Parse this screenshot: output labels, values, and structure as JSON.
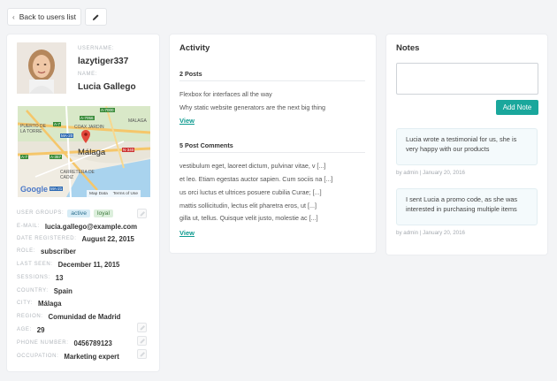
{
  "toolbar": {
    "back_label": "Back to users list",
    "back_icon": "chevron-left-icon",
    "edit_icon": "pencil-icon"
  },
  "profile": {
    "username_label": "USERNAME:",
    "username": "lazytiger337",
    "name_label": "NAME:",
    "name": "Lucia Gallego",
    "map": {
      "labels": [
        "PUERTO DE LA TORRE",
        "COAX JARDIN",
        "MALAGA",
        "Málaga",
        "CARRETERA DE CADIZ",
        "A-7",
        "MA-20",
        "A-357",
        "A-7056",
        "A-7000",
        "N-340",
        "MA-21",
        "A-7"
      ],
      "footer_left": "Google",
      "footer_mid": "Map Data",
      "footer_right": "Terms of Use"
    },
    "fields": [
      {
        "label": "USER GROUPS:",
        "value": "",
        "tags": [
          "active",
          "loyal"
        ],
        "editable": true
      },
      {
        "label": "E-MAIL:",
        "value": "lucia.gallego@example.com",
        "editable": false
      },
      {
        "label": "DATE REGISTERED:",
        "value": "August 22, 2015",
        "editable": false
      },
      {
        "label": "ROLE:",
        "value": "subscriber",
        "editable": false
      },
      {
        "label": "LAST SEEN:",
        "value": "December 11, 2015",
        "editable": false
      },
      {
        "label": "SESSIONS:",
        "value": "13",
        "editable": false
      },
      {
        "label": "COUNTRY:",
        "value": "Spain",
        "editable": false
      },
      {
        "label": "CITY:",
        "value": "Málaga",
        "editable": false
      },
      {
        "label": "REGION:",
        "value": "Comunidad de Madrid",
        "editable": false
      },
      {
        "label": "AGE:",
        "value": "29",
        "editable": true
      },
      {
        "label": "PHONE NUMBER:",
        "value": "0456789123",
        "editable": true
      },
      {
        "label": "OCCUPATION:",
        "value": "Marketing expert",
        "editable": true
      }
    ]
  },
  "activity": {
    "title": "Activity",
    "posts_heading": "2 Posts",
    "posts": [
      "Flexbox for interfaces all the way",
      "Why static website generators are the next big thing"
    ],
    "posts_view": "View",
    "comments_heading": "5 Post Comments",
    "comments": [
      "vestibulum eget, laoreet dictum, pulvinar vitae, v [...]",
      "et leo. Etiam egestas auctor sapien. Cum sociis na [...]",
      "us orci luctus et ultrices posuere cubilia Curae; [...]",
      "mattis sollicitudin, lectus elit pharetra eros, ut [...]",
      "gilla ut, tellus. Quisque velit justo, molestie ac [...]"
    ],
    "comments_view": "View"
  },
  "notes": {
    "title": "Notes",
    "textarea_placeholder": "",
    "add_label": "Add Note",
    "accent": "#1aa79c",
    "items": [
      {
        "text": "Lucia wrote a testimonial for us, she is very happy with our products",
        "meta": "by admin | January 20, 2016"
      },
      {
        "text": "I sent Lucia a promo code, as she was interested in purchasing multiple items",
        "meta": "by admin | January 20, 2016"
      }
    ]
  }
}
